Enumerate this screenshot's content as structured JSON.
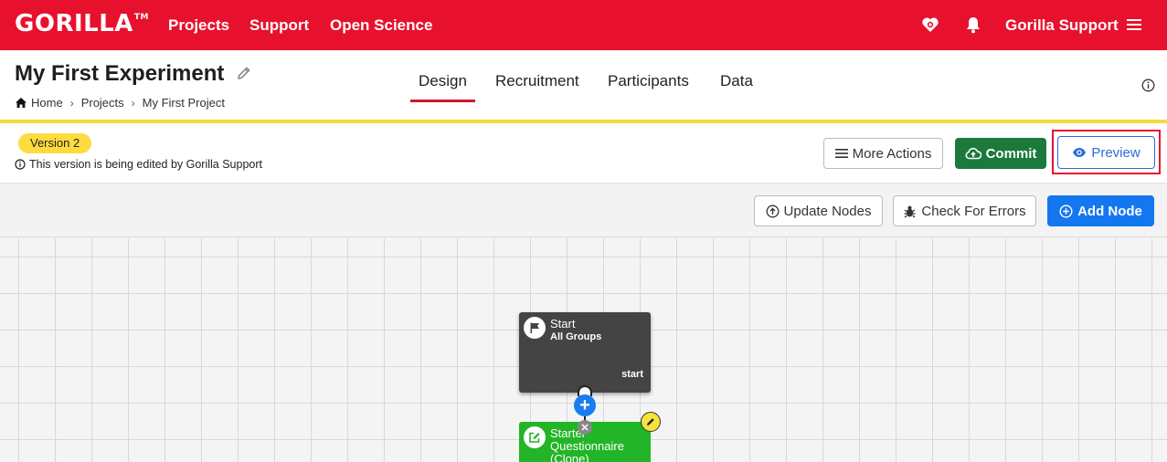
{
  "topbar": {
    "logo": "GORILLA",
    "logo_tm": "TM",
    "nav": [
      "Projects",
      "Support",
      "Open Science"
    ],
    "user_name": "Gorilla Support",
    "icons": [
      "heart-badge-icon",
      "bell-icon",
      "menu-icon"
    ]
  },
  "header": {
    "title": "My First Experiment",
    "breadcrumb": [
      "Home",
      "Projects",
      "My First Project"
    ],
    "tabs": [
      "Design",
      "Recruitment",
      "Participants",
      "Data"
    ],
    "active_tab": "Design"
  },
  "version": {
    "badge": "Version 2",
    "note": "This version is being edited by Gorilla Support"
  },
  "actions": {
    "more_actions": "More Actions",
    "commit": "Commit",
    "preview": "Preview"
  },
  "toolbar": {
    "update_nodes": "Update Nodes",
    "check_errors": "Check For Errors",
    "add_node": "Add Node"
  },
  "nodes": {
    "start": {
      "title": "Start",
      "subtitle": "All Groups",
      "tag": "start"
    },
    "questionnaire": {
      "title": "Starter Questionnaire (Clone)"
    }
  },
  "colors": {
    "brand_red": "#e8112d",
    "accent_yellow": "#f5dc3a",
    "commit_green": "#1b7a3b",
    "primary_blue": "#1577f0",
    "node_start": "#444444",
    "node_questionnaire": "#22b527"
  }
}
